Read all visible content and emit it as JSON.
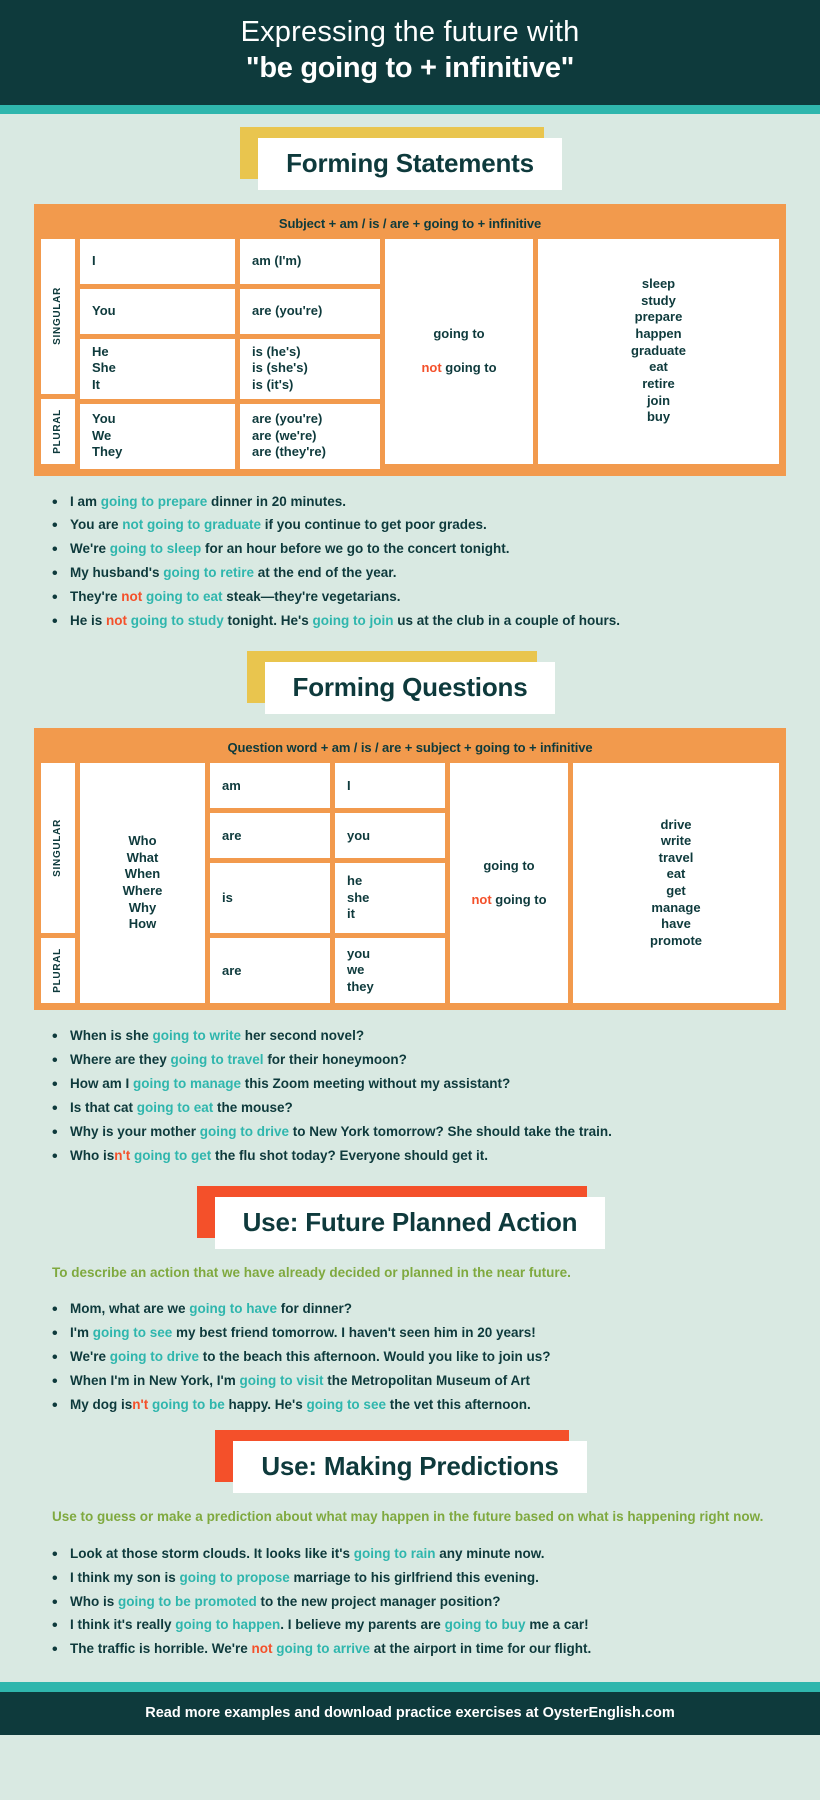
{
  "colors": {
    "dark_teal": "#0e3a3c",
    "teal_accent": "#2fb6ad",
    "bg": "#d9e9e2",
    "orange": "#f29a4d",
    "red": "#f4502a",
    "yellow": "#e9c54e",
    "green": "#7fa93f"
  },
  "header": {
    "line1": "Expressing the future with",
    "line2": "\"be going to + infinitive\""
  },
  "statements": {
    "banner": "Forming Statements",
    "formula": "Subject + am / is / are + going to + infinitive",
    "labels": {
      "singular": "SINGULAR",
      "plural": "PLURAL"
    },
    "rows": [
      {
        "subject": "I",
        "verb": "am (I'm)"
      },
      {
        "subject": "You",
        "verb": "are (you're)"
      },
      {
        "subject": "He\nShe\nIt",
        "verb": "is (he's)\nis (she's)\nis (it's)"
      },
      {
        "subject": "You\nWe\nThey",
        "verb": "are (you're)\nare (we're)\nare (they're)"
      }
    ],
    "going_to": "going to",
    "not_word": "not",
    "not_going_to": "going to",
    "verbs": "sleep\nstudy\nprepare\nhappen\ngraduate\neat\nretire\njoin\nbuy",
    "examples": [
      [
        {
          "t": "I am ",
          "s": "n"
        },
        {
          "t": "going to prepare",
          "s": "h"
        },
        {
          "t": " dinner in 20 minutes.",
          "s": "n"
        }
      ],
      [
        {
          "t": "You are ",
          "s": "n"
        },
        {
          "t": "not going to graduate",
          "s": "h"
        },
        {
          "t": " if you continue to get poor grades.",
          "s": "n"
        }
      ],
      [
        {
          "t": "We're ",
          "s": "n"
        },
        {
          "t": "going to sleep",
          "s": "h"
        },
        {
          "t": " for an hour before we go to the concert tonight.",
          "s": "n"
        }
      ],
      [
        {
          "t": "My husband's ",
          "s": "n"
        },
        {
          "t": "going to retire",
          "s": "h"
        },
        {
          "t": " at the end of the year.",
          "s": "n"
        }
      ],
      [
        {
          "t": "They're ",
          "s": "n"
        },
        {
          "t": "not",
          "s": "r"
        },
        {
          "t": " ",
          "s": "n"
        },
        {
          "t": "going to eat",
          "s": "h"
        },
        {
          "t": " steak—they're vegetarians.",
          "s": "n"
        }
      ],
      [
        {
          "t": "He is ",
          "s": "n"
        },
        {
          "t": "not",
          "s": "r"
        },
        {
          "t": " ",
          "s": "n"
        },
        {
          "t": "going to study",
          "s": "h"
        },
        {
          "t": " tonight. He's ",
          "s": "n"
        },
        {
          "t": "going to join",
          "s": "h"
        },
        {
          "t": " us at the club in a couple of hours.",
          "s": "n"
        }
      ]
    ]
  },
  "questions": {
    "banner": "Forming Questions",
    "formula": "Question word + am / is / are + subject + going to + infinitive",
    "labels": {
      "singular": "SINGULAR",
      "plural": "PLURAL"
    },
    "question_words": "Who\nWhat\nWhen\nWhere\nWhy\nHow",
    "rows": [
      {
        "be": "am",
        "subject": "I"
      },
      {
        "be": "are",
        "subject": "you"
      },
      {
        "be": "is",
        "subject": "he\nshe\nit"
      },
      {
        "be": "are",
        "subject": "you\nwe\nthey"
      }
    ],
    "going_to": "going to",
    "not_word": "not",
    "not_going_to": "going to",
    "verbs": "drive\nwrite\ntravel\neat\nget\nmanage\nhave\npromote",
    "examples": [
      [
        {
          "t": "When is she ",
          "s": "n"
        },
        {
          "t": "going to write",
          "s": "h"
        },
        {
          "t": " her second novel?",
          "s": "n"
        }
      ],
      [
        {
          "t": "Where are they ",
          "s": "n"
        },
        {
          "t": "going to travel",
          "s": "h"
        },
        {
          "t": " for their honeymoon?",
          "s": "n"
        }
      ],
      [
        {
          "t": "How am I ",
          "s": "n"
        },
        {
          "t": "going to manage",
          "s": "h"
        },
        {
          "t": " this Zoom meeting without my assistant?",
          "s": "n"
        }
      ],
      [
        {
          "t": "Is that cat ",
          "s": "n"
        },
        {
          "t": "going to eat",
          "s": "h"
        },
        {
          "t": " the mouse?",
          "s": "n"
        }
      ],
      [
        {
          "t": "Why is your mother ",
          "s": "n"
        },
        {
          "t": "going to drive",
          "s": "h"
        },
        {
          "t": " to New York tomorrow? She should take the train.",
          "s": "n"
        }
      ],
      [
        {
          "t": "Who is",
          "s": "n"
        },
        {
          "t": "n't",
          "s": "r"
        },
        {
          "t": " ",
          "s": "n"
        },
        {
          "t": "going to get",
          "s": "h"
        },
        {
          "t": " the flu shot today? Everyone should get it.",
          "s": "n"
        }
      ]
    ]
  },
  "use_planned": {
    "banner": "Use: Future Planned Action",
    "description": "To describe an action that we have already decided or planned in the near future.",
    "examples": [
      [
        {
          "t": "Mom, what are we ",
          "s": "n"
        },
        {
          "t": "going to have",
          "s": "h"
        },
        {
          "t": " for dinner?",
          "s": "n"
        }
      ],
      [
        {
          "t": "I'm ",
          "s": "n"
        },
        {
          "t": "going to see",
          "s": "h"
        },
        {
          "t": " my best friend tomorrow. I haven't seen him in 20 years!",
          "s": "n"
        }
      ],
      [
        {
          "t": "We're ",
          "s": "n"
        },
        {
          "t": "going to drive",
          "s": "h"
        },
        {
          "t": " to the beach this afternoon. Would you like to join us?",
          "s": "n"
        }
      ],
      [
        {
          "t": "When I'm in New York, I'm ",
          "s": "n"
        },
        {
          "t": "going to visit",
          "s": "h"
        },
        {
          "t": " the Metropolitan Museum of Art",
          "s": "n"
        }
      ],
      [
        {
          "t": "My dog is",
          "s": "n"
        },
        {
          "t": "n't",
          "s": "r"
        },
        {
          "t": " ",
          "s": "n"
        },
        {
          "t": "going to be",
          "s": "h"
        },
        {
          "t": " happy. He's ",
          "s": "n"
        },
        {
          "t": "going to see",
          "s": "h"
        },
        {
          "t": " the vet this afternoon.",
          "s": "n"
        }
      ]
    ]
  },
  "use_predictions": {
    "banner": "Use:  Making Predictions",
    "description": "Use to guess or make a prediction about what may happen in the future based on what is happening right now.",
    "examples": [
      [
        {
          "t": "Look at those storm clouds. It looks like it's ",
          "s": "n"
        },
        {
          "t": "going to rain",
          "s": "h"
        },
        {
          "t": " any minute now.",
          "s": "n"
        }
      ],
      [
        {
          "t": "I think my son is ",
          "s": "n"
        },
        {
          "t": "going to propose",
          "s": "h"
        },
        {
          "t": " marriage to his girlfriend this evening.",
          "s": "n"
        }
      ],
      [
        {
          "t": "Who is ",
          "s": "n"
        },
        {
          "t": "going to be promoted",
          "s": "h"
        },
        {
          "t": " to the new project manager position?",
          "s": "n"
        }
      ],
      [
        {
          "t": "I think it's really ",
          "s": "n"
        },
        {
          "t": "going to happen",
          "s": "h"
        },
        {
          "t": ".  I believe my parents are ",
          "s": "n"
        },
        {
          "t": "going to buy",
          "s": "h"
        },
        {
          "t": " me a car!",
          "s": "n"
        }
      ],
      [
        {
          "t": "The traffic is horrible. We're ",
          "s": "n"
        },
        {
          "t": "not",
          "s": "r"
        },
        {
          "t": " ",
          "s": "n"
        },
        {
          "t": "going to arrive",
          "s": "h"
        },
        {
          "t": " at the airport in time for our flight.",
          "s": "n"
        }
      ]
    ]
  },
  "footer": {
    "text": "Read more examples and download practice exercises at OysterEnglish.com"
  }
}
